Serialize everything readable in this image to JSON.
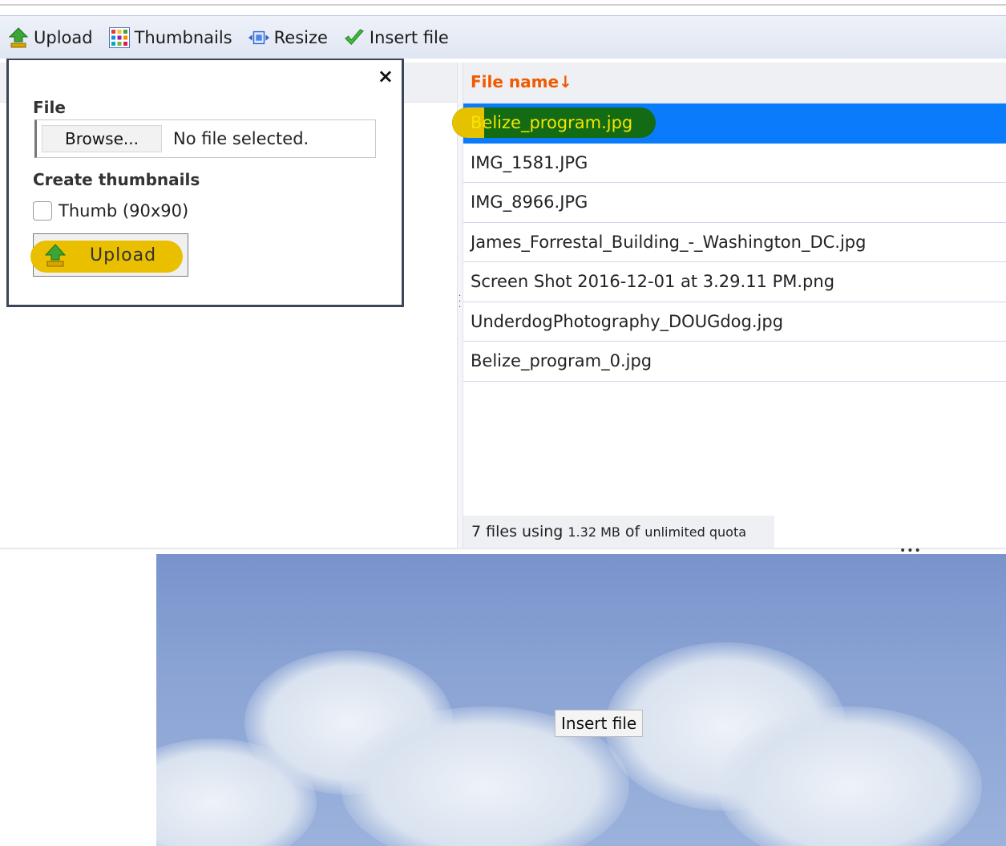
{
  "toolbar": {
    "upload": "Upload",
    "thumbnails": "Thumbnails",
    "resize": "Resize",
    "insert_file": "Insert file"
  },
  "upload_dialog": {
    "close": "×",
    "file_label": "File",
    "browse_label": "Browse...",
    "no_file_text": "No file selected.",
    "thumbs_label": "Create thumbnails",
    "thumb_option": "Thumb (90x90)",
    "thumb_checked": false,
    "upload_button": "Upload"
  },
  "file_list": {
    "column_header": "File name↓",
    "files": [
      "Belize_program.jpg",
      "IMG_1581.JPG",
      "IMG_8966.JPG",
      "James_Forrestal_Building_-_Washington_DC.jpg",
      "Screen Shot 2016-12-01 at 3.29.11 PM.png",
      "UnderdogPhotography_DOUGdog.jpg",
      "Belize_program_0.jpg"
    ],
    "selected_index": 0,
    "status": {
      "count_text": "7 files using",
      "size": "1.32 MB",
      "of": "of",
      "quota": "unlimited quota"
    }
  },
  "preview": {
    "tooltip": "Insert file"
  },
  "colors": {
    "accent_orange": "#f05a00",
    "selection_blue": "#0a7bfa",
    "highlight_yellow": "#e9bf00"
  }
}
